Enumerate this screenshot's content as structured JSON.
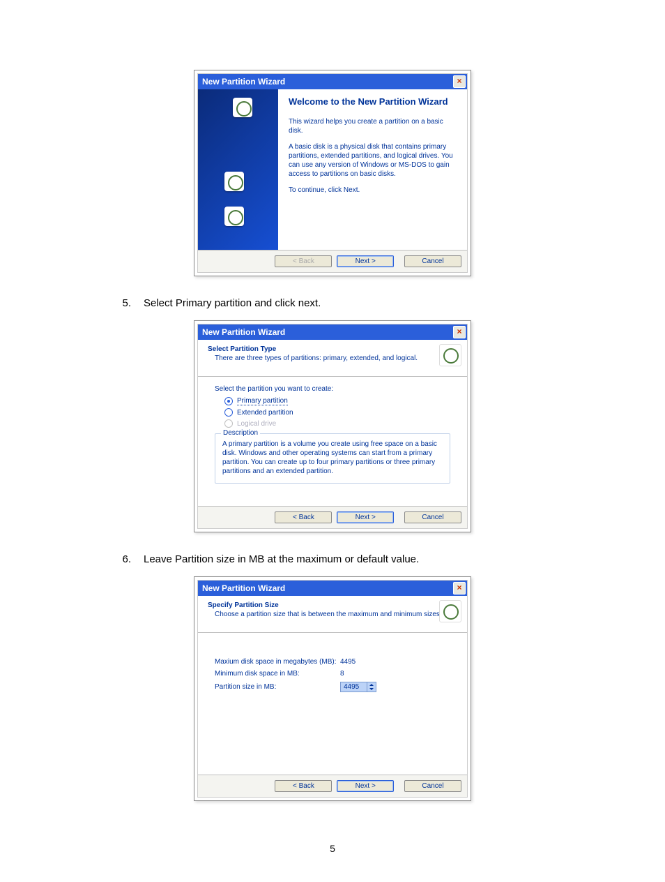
{
  "steps": {
    "s5": "Select Primary partition and click next.",
    "s6": "Leave Partition size in MB at the maximum or default value."
  },
  "page_number": "5",
  "dialog1": {
    "title": "New Partition Wizard",
    "heading": "Welcome to the New Partition Wizard",
    "p1": "This wizard helps you create a partition on a basic disk.",
    "p2": "A basic disk is a physical disk that contains primary partitions, extended partitions, and logical drives. You can use any version of Windows or MS-DOS to gain access to partitions on basic disks.",
    "p3": "To continue, click Next.",
    "back": "< Back",
    "next": "Next >",
    "cancel": "Cancel"
  },
  "dialog2": {
    "title": "New Partition Wizard",
    "hdr_title": "Select Partition Type",
    "hdr_sub": "There are three types of partitions: primary, extended, and logical.",
    "prompt": "Select the partition you want to create:",
    "opt_primary": "Primary partition",
    "opt_extended": "Extended partition",
    "opt_logical": "Logical drive",
    "desc_legend": "Description",
    "desc_text": "A primary partition is a volume you create using free space on a basic disk. Windows and other operating systems can start from a primary partition. You can create up to four primary partitions or three primary partitions and an extended partition.",
    "back": "< Back",
    "next": "Next >",
    "cancel": "Cancel"
  },
  "dialog3": {
    "title": "New Partition Wizard",
    "hdr_title": "Specify Partition Size",
    "hdr_sub": "Choose a partition size that is between the maximum and minimum sizes.",
    "row1_lbl": "Maxium disk space in megabytes (MB):",
    "row1_val": "4495",
    "row2_lbl": "Minimum disk space in MB:",
    "row2_val": "8",
    "row3_lbl": "Partition size in MB:",
    "row3_val": "4495",
    "back": "< Back",
    "next": "Next >",
    "cancel": "Cancel"
  }
}
